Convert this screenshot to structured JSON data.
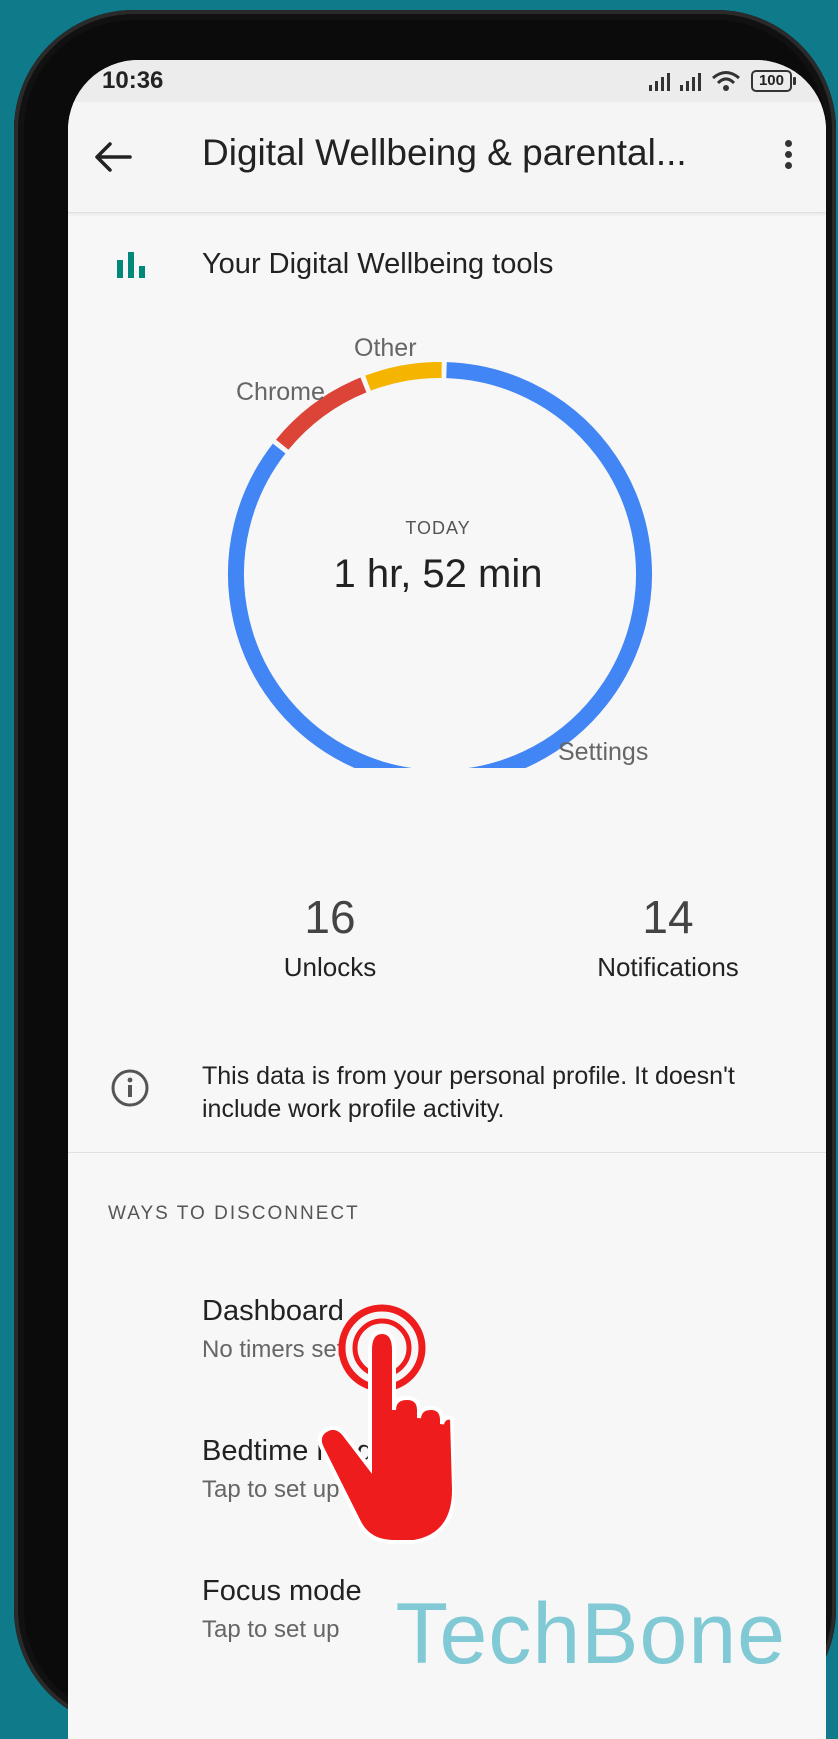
{
  "status": {
    "time": "10:36",
    "battery": "100"
  },
  "appbar": {
    "title": "Digital Wellbeing & parental...",
    "back_icon": "arrow-back-icon",
    "more_icon": "more-vert-icon"
  },
  "tools": {
    "icon": "bar-chart-icon",
    "label": "Your Digital Wellbeing tools"
  },
  "chart_data": {
    "type": "pie",
    "style": "donut",
    "center_caption": "TODAY",
    "center_value": "1 hr, 52 min",
    "series": [
      {
        "name": "Settings",
        "fraction": 0.82,
        "color": "#4285f4"
      },
      {
        "name": "Chrome",
        "fraction": 0.08,
        "color": "#db4437"
      },
      {
        "name": "Other",
        "fraction": 0.06,
        "color": "#f4b400"
      }
    ]
  },
  "stats": {
    "unlocks_value": "16",
    "unlocks_label": "Unlocks",
    "notifications_value": "14",
    "notifications_label": "Notifications"
  },
  "info": {
    "icon": "info-icon",
    "text": "This data is from your personal profile. It doesn't include work profile activity."
  },
  "disconnect": {
    "heading": "WAYS TO DISCONNECT",
    "items": [
      {
        "title": "Dashboard",
        "subtitle": "No timers set"
      },
      {
        "title": "Bedtime mode",
        "subtitle": "Tap to set up"
      },
      {
        "title": "Focus mode",
        "subtitle": "Tap to set up"
      }
    ]
  },
  "watermark": "TechBone",
  "colors": {
    "accent_teal": "#00897b",
    "settings_blue": "#4285f4",
    "chrome_red": "#db4437",
    "other_yellow": "#f4b400",
    "tap_hand_red": "#ee1c1c"
  }
}
